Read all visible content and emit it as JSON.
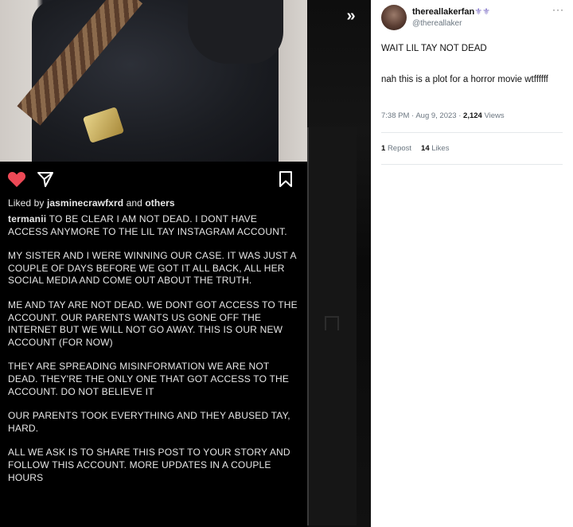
{
  "instagram": {
    "liked_prefix": "Liked by",
    "liked_user": "jasminecrawfxrd",
    "liked_and": "and",
    "liked_others": "others",
    "caption_user": "termanii",
    "caption_paragraphs": [
      "TO BE CLEAR I AM NOT DEAD. I DONT HAVE ACCESS ANYMORE TO THE LIL TAY INSTAGRAM ACCOUNT.",
      "MY SISTER AND I WERE WINNING OUR CASE. IT WAS JUST A COUPLE OF DAYS BEFORE WE GOT IT ALL BACK, ALL HER SOCIAL MEDIA AND COME OUT ABOUT THE TRUTH.",
      "ME AND TAY ARE NOT DEAD. WE DONT GOT ACCESS TO THE ACCOUNT. OUR PARENTS WANTS US GONE OFF THE INTERNET BUT WE WILL NOT GO AWAY. THIS IS OUR NEW ACCOUNT (FOR NOW)",
      "THEY ARE SPREADING MISINFORMATION WE ARE NOT DEAD. THEY'RE THE ONLY ONE THAT GOT ACCESS TO THE ACCOUNT. DO NOT BELIEVE IT",
      "OUR PARENTS TOOK EVERYTHING AND THEY ABUSED TAY, HARD.",
      "ALL WE ASK IS TO SHARE THIS POST TO YOUR STORY AND FOLLOW THIS ACCOUNT. MORE UPDATES IN A COUPLE HOURS"
    ],
    "icons": [
      "heart-icon",
      "send-icon",
      "bookmark-icon"
    ],
    "heart_color": "#ed4956"
  },
  "viewer": {
    "expand_glyph": "»"
  },
  "tweet": {
    "display_name": "thereallakerfan",
    "name_emoji": "⚜⚜",
    "handle": "@thereallaker",
    "more_glyph": "···",
    "text_line1": "WAIT LIL TAY NOT DEAD",
    "text_line2": "nah this is a plot for a horror movie wtffffff",
    "time": "7:38 PM",
    "dot": "·",
    "date": "Aug 9, 2023",
    "views_count": "2,124",
    "views_label": "Views",
    "reposts_count": "1",
    "reposts_label": "Repost",
    "likes_count": "14",
    "likes_label": "Likes"
  }
}
